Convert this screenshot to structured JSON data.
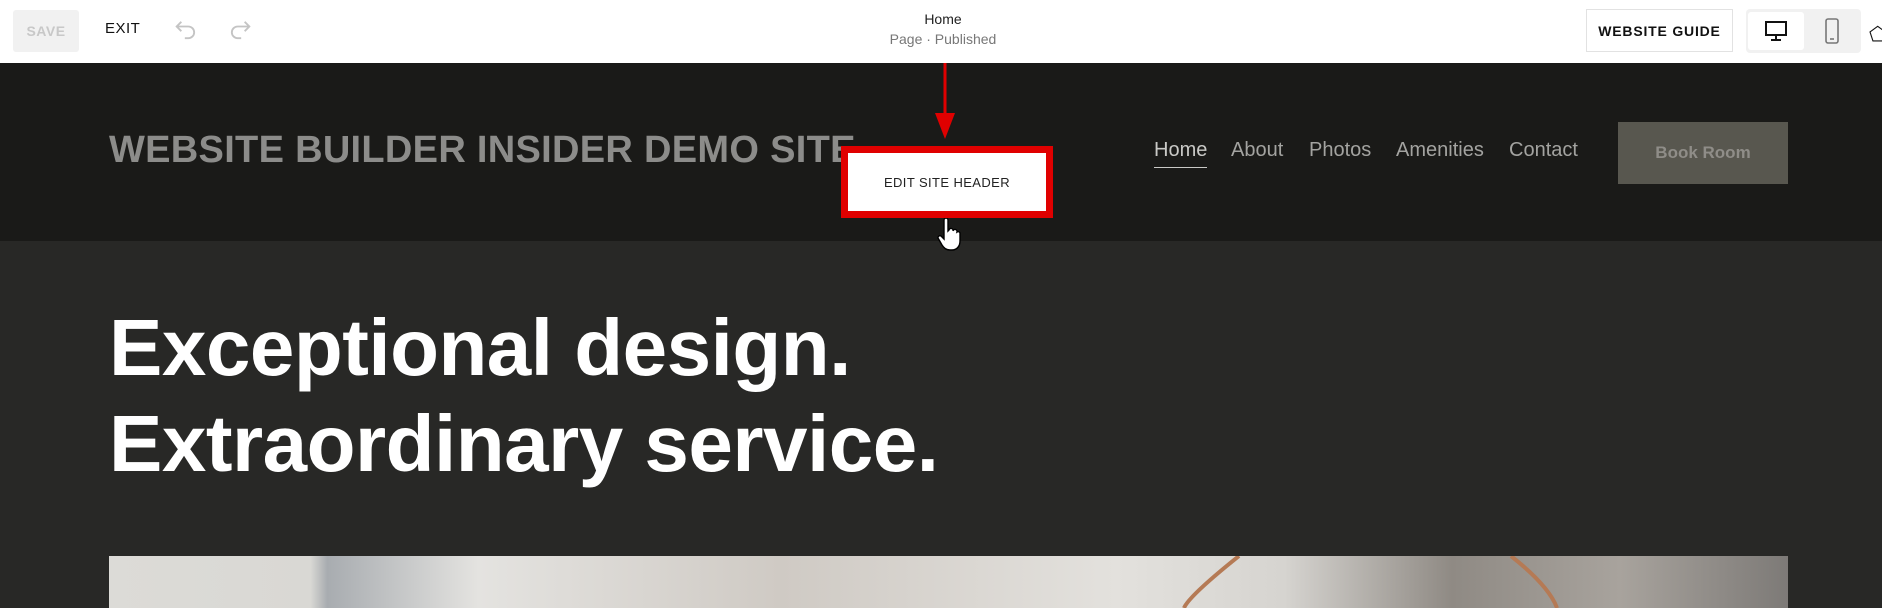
{
  "toolbar": {
    "save": "SAVE",
    "exit": "EXIT",
    "page_title": "Home",
    "page_status": "Page · Published",
    "website_guide": "WEBSITE GUIDE"
  },
  "site": {
    "title": "WEBSITE BUILDER INSIDER DEMO SITE",
    "nav": [
      "Home",
      "About",
      "Photos",
      "Amenities",
      "Contact"
    ],
    "cta": "Book Room",
    "edit_header": "EDIT SITE HEADER"
  },
  "hero": {
    "line1": "Exceptional design.",
    "line2": "Extraordinary service."
  },
  "colors": {
    "annotation": "#e00000",
    "header_bg": "#1a1a18",
    "hero_bg": "#282826"
  }
}
